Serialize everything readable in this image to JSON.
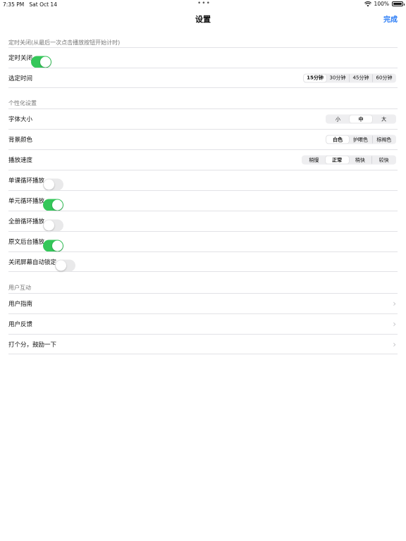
{
  "status": {
    "time": "7:35 PM",
    "date": "Sat Oct 14",
    "battery": "100%"
  },
  "nav": {
    "title": "设置",
    "done": "完成"
  },
  "sections": {
    "timer": {
      "header": "定时关闭(从最后一次点击播放按钮开始计时)",
      "timer_label": "定时关闭",
      "timer_on": true,
      "time_label": "选定时间",
      "time_options": [
        "15分钟",
        "30分钟",
        "45分钟",
        "60分钟"
      ],
      "time_selected": "15分钟"
    },
    "personal": {
      "header": "个性化设置",
      "font_label": "字体大小",
      "font_options": [
        "小",
        "中",
        "大"
      ],
      "font_selected": "中",
      "bg_label": "背景颜色",
      "bg_options": [
        "白色",
        "护眼色",
        "棕褐色"
      ],
      "bg_selected": "白色",
      "speed_label": "播放速度",
      "speed_options": [
        "稍慢",
        "正常",
        "稍快",
        "较快"
      ],
      "speed_selected": "正常",
      "lesson_loop_label": "单课循环播放",
      "lesson_loop_on": false,
      "unit_loop_label": "单元循环播放",
      "unit_loop_on": true,
      "book_loop_label": "全册循环播放",
      "book_loop_on": false,
      "bg_play_label": "原文后台播放",
      "bg_play_on": true,
      "autolock_label": "关闭屏幕自动锁定",
      "autolock_on": false
    },
    "interaction": {
      "header": "用户互动",
      "guide_label": "用户指南",
      "feedback_label": "用户反馈",
      "rate_label": "打个分，鼓励一下"
    }
  },
  "colors": {
    "accent": "#2a7cf6",
    "toggle_on": "#34c759",
    "toggle_off": "#e9e9ea"
  },
  "icons": [
    "wifi-icon",
    "battery-icon",
    "chevron-right-icon"
  ]
}
